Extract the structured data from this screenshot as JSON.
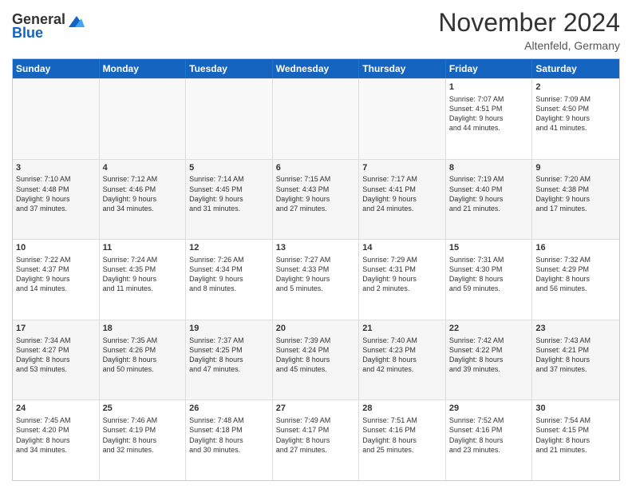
{
  "logo": {
    "general": "General",
    "blue": "Blue"
  },
  "header": {
    "month": "November 2024",
    "location": "Altenfeld, Germany"
  },
  "days": [
    "Sunday",
    "Monday",
    "Tuesday",
    "Wednesday",
    "Thursday",
    "Friday",
    "Saturday"
  ],
  "rows": [
    [
      {
        "day": "",
        "info": ""
      },
      {
        "day": "",
        "info": ""
      },
      {
        "day": "",
        "info": ""
      },
      {
        "day": "",
        "info": ""
      },
      {
        "day": "",
        "info": ""
      },
      {
        "day": "1",
        "info": "Sunrise: 7:07 AM\nSunset: 4:51 PM\nDaylight: 9 hours\nand 44 minutes."
      },
      {
        "day": "2",
        "info": "Sunrise: 7:09 AM\nSunset: 4:50 PM\nDaylight: 9 hours\nand 41 minutes."
      }
    ],
    [
      {
        "day": "3",
        "info": "Sunrise: 7:10 AM\nSunset: 4:48 PM\nDaylight: 9 hours\nand 37 minutes."
      },
      {
        "day": "4",
        "info": "Sunrise: 7:12 AM\nSunset: 4:46 PM\nDaylight: 9 hours\nand 34 minutes."
      },
      {
        "day": "5",
        "info": "Sunrise: 7:14 AM\nSunset: 4:45 PM\nDaylight: 9 hours\nand 31 minutes."
      },
      {
        "day": "6",
        "info": "Sunrise: 7:15 AM\nSunset: 4:43 PM\nDaylight: 9 hours\nand 27 minutes."
      },
      {
        "day": "7",
        "info": "Sunrise: 7:17 AM\nSunset: 4:41 PM\nDaylight: 9 hours\nand 24 minutes."
      },
      {
        "day": "8",
        "info": "Sunrise: 7:19 AM\nSunset: 4:40 PM\nDaylight: 9 hours\nand 21 minutes."
      },
      {
        "day": "9",
        "info": "Sunrise: 7:20 AM\nSunset: 4:38 PM\nDaylight: 9 hours\nand 17 minutes."
      }
    ],
    [
      {
        "day": "10",
        "info": "Sunrise: 7:22 AM\nSunset: 4:37 PM\nDaylight: 9 hours\nand 14 minutes."
      },
      {
        "day": "11",
        "info": "Sunrise: 7:24 AM\nSunset: 4:35 PM\nDaylight: 9 hours\nand 11 minutes."
      },
      {
        "day": "12",
        "info": "Sunrise: 7:26 AM\nSunset: 4:34 PM\nDaylight: 9 hours\nand 8 minutes."
      },
      {
        "day": "13",
        "info": "Sunrise: 7:27 AM\nSunset: 4:33 PM\nDaylight: 9 hours\nand 5 minutes."
      },
      {
        "day": "14",
        "info": "Sunrise: 7:29 AM\nSunset: 4:31 PM\nDaylight: 9 hours\nand 2 minutes."
      },
      {
        "day": "15",
        "info": "Sunrise: 7:31 AM\nSunset: 4:30 PM\nDaylight: 8 hours\nand 59 minutes."
      },
      {
        "day": "16",
        "info": "Sunrise: 7:32 AM\nSunset: 4:29 PM\nDaylight: 8 hours\nand 56 minutes."
      }
    ],
    [
      {
        "day": "17",
        "info": "Sunrise: 7:34 AM\nSunset: 4:27 PM\nDaylight: 8 hours\nand 53 minutes."
      },
      {
        "day": "18",
        "info": "Sunrise: 7:35 AM\nSunset: 4:26 PM\nDaylight: 8 hours\nand 50 minutes."
      },
      {
        "day": "19",
        "info": "Sunrise: 7:37 AM\nSunset: 4:25 PM\nDaylight: 8 hours\nand 47 minutes."
      },
      {
        "day": "20",
        "info": "Sunrise: 7:39 AM\nSunset: 4:24 PM\nDaylight: 8 hours\nand 45 minutes."
      },
      {
        "day": "21",
        "info": "Sunrise: 7:40 AM\nSunset: 4:23 PM\nDaylight: 8 hours\nand 42 minutes."
      },
      {
        "day": "22",
        "info": "Sunrise: 7:42 AM\nSunset: 4:22 PM\nDaylight: 8 hours\nand 39 minutes."
      },
      {
        "day": "23",
        "info": "Sunrise: 7:43 AM\nSunset: 4:21 PM\nDaylight: 8 hours\nand 37 minutes."
      }
    ],
    [
      {
        "day": "24",
        "info": "Sunrise: 7:45 AM\nSunset: 4:20 PM\nDaylight: 8 hours\nand 34 minutes."
      },
      {
        "day": "25",
        "info": "Sunrise: 7:46 AM\nSunset: 4:19 PM\nDaylight: 8 hours\nand 32 minutes."
      },
      {
        "day": "26",
        "info": "Sunrise: 7:48 AM\nSunset: 4:18 PM\nDaylight: 8 hours\nand 30 minutes."
      },
      {
        "day": "27",
        "info": "Sunrise: 7:49 AM\nSunset: 4:17 PM\nDaylight: 8 hours\nand 27 minutes."
      },
      {
        "day": "28",
        "info": "Sunrise: 7:51 AM\nSunset: 4:16 PM\nDaylight: 8 hours\nand 25 minutes."
      },
      {
        "day": "29",
        "info": "Sunrise: 7:52 AM\nSunset: 4:16 PM\nDaylight: 8 hours\nand 23 minutes."
      },
      {
        "day": "30",
        "info": "Sunrise: 7:54 AM\nSunset: 4:15 PM\nDaylight: 8 hours\nand 21 minutes."
      }
    ]
  ]
}
